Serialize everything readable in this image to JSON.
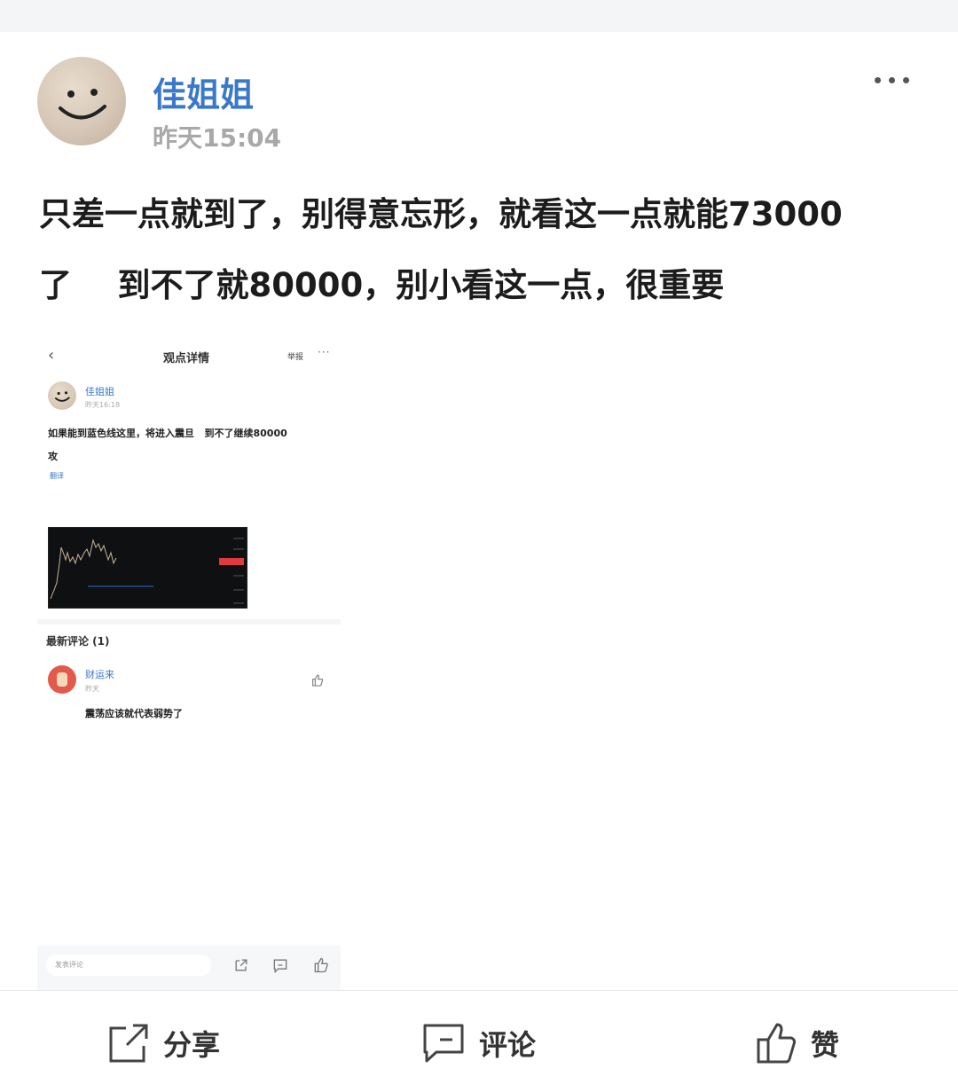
{
  "post": {
    "author": "佳姐姐",
    "time": "昨天15:04",
    "more_icon": "more-icon",
    "content": "只差一点就到了，别得意忘形，就看这一点就能73000\n了    到不了就80000，别小看这一点，很重要"
  },
  "embedded": {
    "title": "观点详情",
    "report": "举报",
    "author": "佳姐姐",
    "time": "昨天16:18",
    "text": "如果能到蓝色线这里，将进入震旦   到不了继续80000\n攻",
    "translate": "翻译",
    "comments_title": "最新评论 (1)",
    "comment": {
      "name": "财运来",
      "time": "昨天",
      "text": "震荡应该就代表弱势了"
    },
    "input_placeholder": "发表评论"
  },
  "actions": {
    "share": "分享",
    "comment": "评论",
    "like": "赞"
  },
  "colors": {
    "author_blue": "#3a78c9",
    "chart_bg": "#0f1012",
    "chart_line": "#c9b59a",
    "chart_blue_line": "#2f6fd1",
    "price_tag_red": "#e0393e"
  }
}
